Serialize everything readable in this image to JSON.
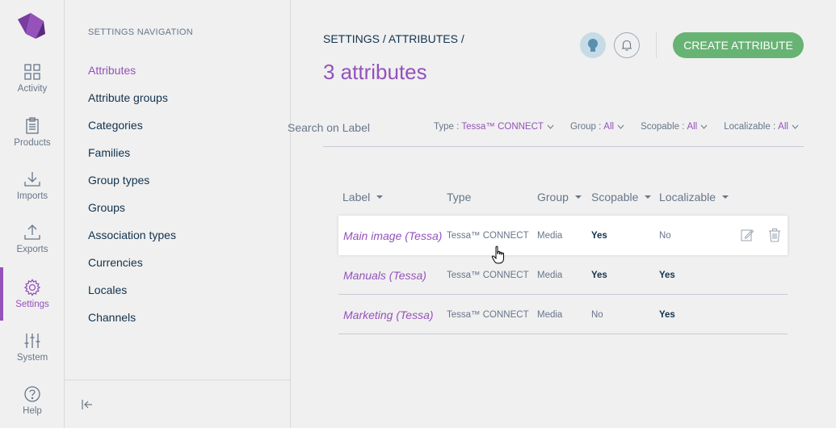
{
  "main_nav": [
    {
      "id": "activity",
      "label": "Activity",
      "icon": "activity-icon"
    },
    {
      "id": "products",
      "label": "Products",
      "icon": "clipboard-icon"
    },
    {
      "id": "imports",
      "label": "Imports",
      "icon": "import-icon"
    },
    {
      "id": "exports",
      "label": "Exports",
      "icon": "export-icon"
    },
    {
      "id": "settings",
      "label": "Settings",
      "icon": "gear-icon",
      "active": true
    },
    {
      "id": "system",
      "label": "System",
      "icon": "sliders-icon"
    },
    {
      "id": "help",
      "label": "Help",
      "icon": "help-icon"
    }
  ],
  "settings_nav": {
    "title": "SETTINGS NAVIGATION",
    "items": [
      "Attributes",
      "Attribute groups",
      "Categories",
      "Families",
      "Group types",
      "Groups",
      "Association types",
      "Currencies",
      "Locales",
      "Channels"
    ],
    "active_index": 0
  },
  "header": {
    "breadcrumb": "SETTINGS / ATTRIBUTES /",
    "title": "3 attributes",
    "create_button": "CREATE ATTRIBUTE"
  },
  "search": {
    "placeholder": "Search on Label"
  },
  "filters": [
    {
      "label": "Type :",
      "value": "Tessa™ CONNECT"
    },
    {
      "label": "Group :",
      "value": "All"
    },
    {
      "label": "Scopable :",
      "value": "All"
    },
    {
      "label": "Localizable :",
      "value": "All"
    }
  ],
  "table": {
    "columns": [
      "Label",
      "Type",
      "Group",
      "Scopable",
      "Localizable"
    ],
    "rows": [
      {
        "label": "Main image (Tessa)",
        "type": "Tessa™ CONNECT",
        "group": "Media",
        "scopable": "Yes",
        "localizable": "No"
      },
      {
        "label": "Manuals (Tessa)",
        "type": "Tessa™ CONNECT",
        "group": "Media",
        "scopable": "Yes",
        "localizable": "Yes"
      },
      {
        "label": "Marketing (Tessa)",
        "type": "Tessa™ CONNECT",
        "group": "Media",
        "scopable": "No",
        "localizable": "Yes"
      }
    ]
  },
  "colors": {
    "accent": "#9452ba",
    "create": "#67b373",
    "text": "#67768a",
    "dark": "#11324d"
  }
}
